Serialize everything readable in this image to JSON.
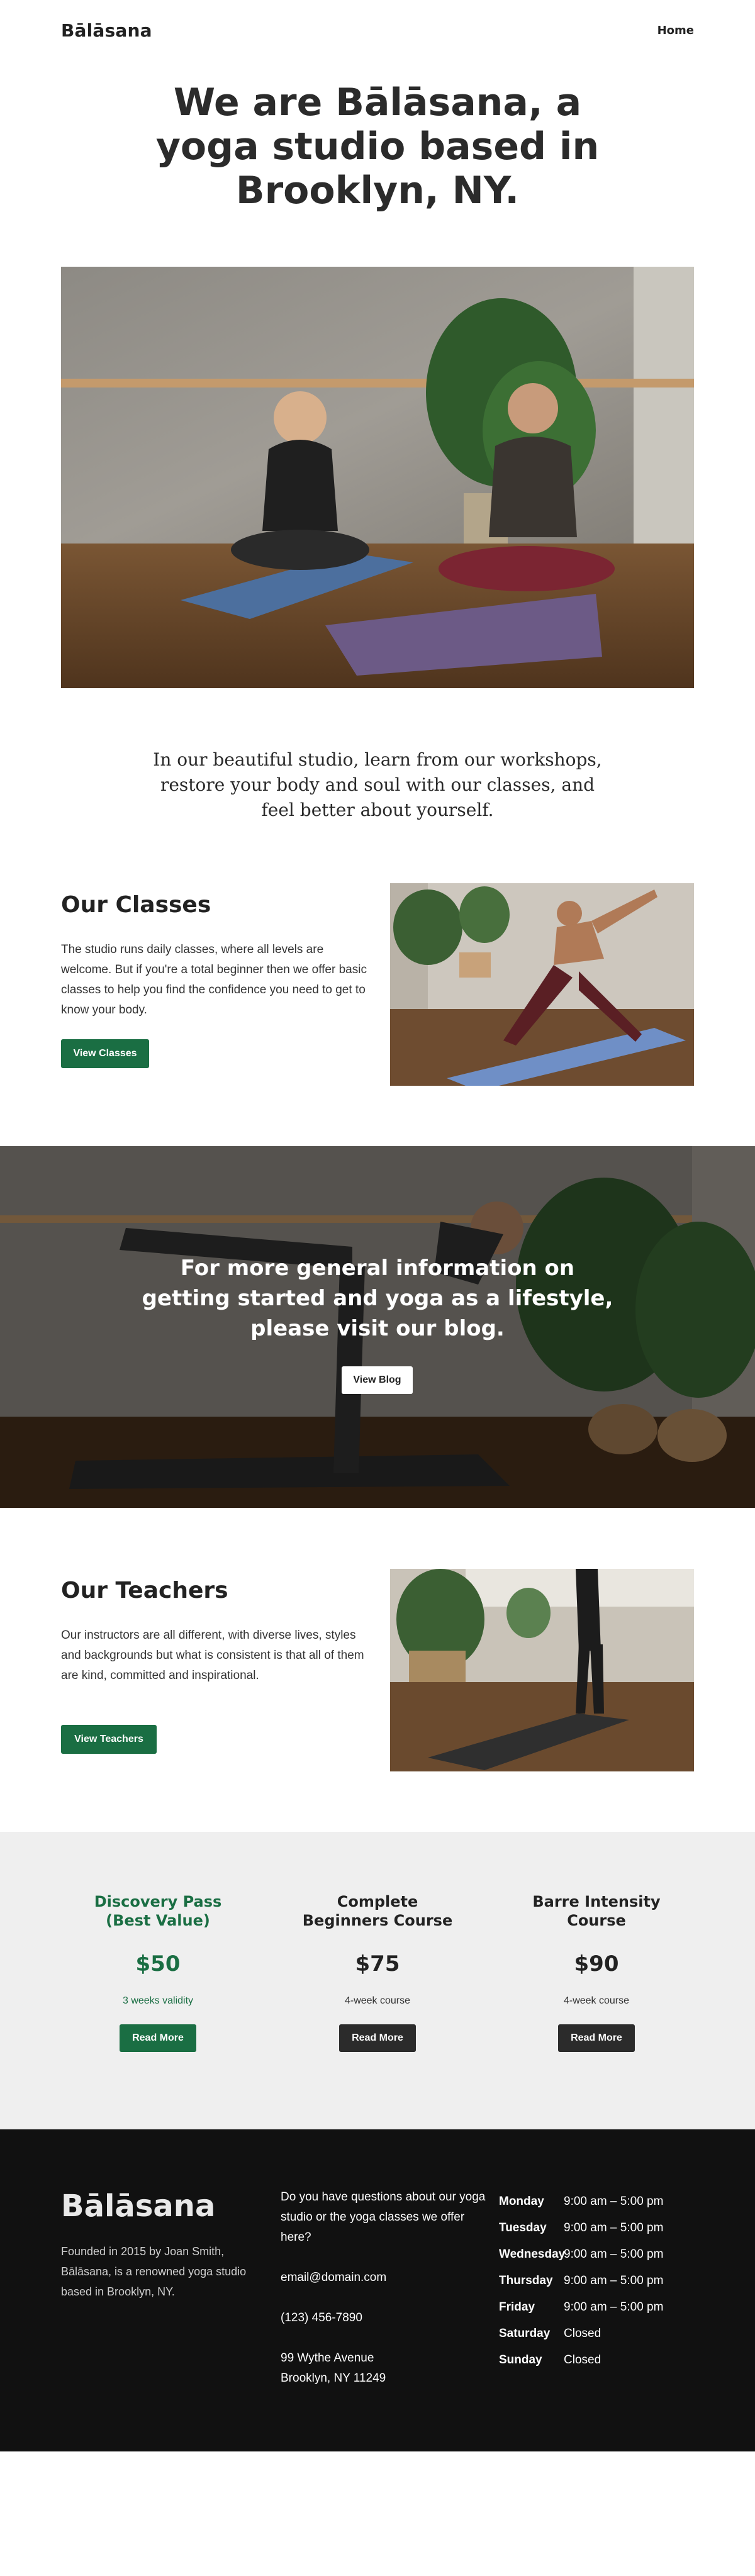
{
  "header": {
    "logo": "Bālāsana",
    "nav": {
      "home": "Home"
    }
  },
  "hero": {
    "title": "We are Bālāsana, a yoga studio based in Brooklyn, NY."
  },
  "intro": {
    "text": "In our beautiful studio, learn from our workshops, restore your body and soul with our classes, and feel better about yourself."
  },
  "classes": {
    "title": "Our Classes",
    "text": "The studio runs daily classes, where all levels are welcome. But if you're a total beginner then we offer basic classes to help you find the confidence you need to get to know your body.",
    "button": "View Classes"
  },
  "banner": {
    "text": "For more general information on getting started and yoga as a lifestyle, please visit our blog.",
    "button": "View Blog"
  },
  "teachers": {
    "title": "Our Teachers",
    "text": "Our instructors are all different, with diverse lives, styles and backgrounds but what is consistent is that all of them are kind, committed and inspirational.",
    "button": "View Teachers"
  },
  "pricing": {
    "plans": [
      {
        "title": "Discovery Pass (Best Value)",
        "price": "$50",
        "sub": "3 weeks validity",
        "button": "Read More"
      },
      {
        "title": "Complete Beginners Course",
        "price": "$75",
        "sub": "4-week course",
        "button": "Read More"
      },
      {
        "title": "Barre Intensity Course",
        "price": "$90",
        "sub": "4-week course",
        "button": "Read More"
      }
    ]
  },
  "footer": {
    "logo": "Bālāsana",
    "about": "Founded in 2015 by Joan Smith, Bālāsana, is a renowned yoga studio based in Brooklyn, NY.",
    "question": "Do you have questions about our yoga studio or the yoga classes we offer here?",
    "email": "email@domain.com",
    "phone": "(123) 456-7890",
    "address_line1": "99 Wythe Avenue",
    "address_line2": "Brooklyn, NY 11249",
    "hours": [
      {
        "day": "Monday",
        "time": "9:00 am – 5:00 pm"
      },
      {
        "day": "Tuesday",
        "time": "9:00 am – 5:00 pm"
      },
      {
        "day": "Wednesday",
        "time": "9:00 am – 5:00 pm"
      },
      {
        "day": "Thursday",
        "time": "9:00 am – 5:00 pm"
      },
      {
        "day": "Friday",
        "time": "9:00 am – 5:00 pm"
      },
      {
        "day": "Saturday",
        "time": "Closed"
      },
      {
        "day": "Sunday",
        "time": "Closed"
      }
    ]
  },
  "colors": {
    "accent_green": "#1a6e43",
    "footer_bg": "#111111",
    "pricing_bg": "#efefef"
  }
}
